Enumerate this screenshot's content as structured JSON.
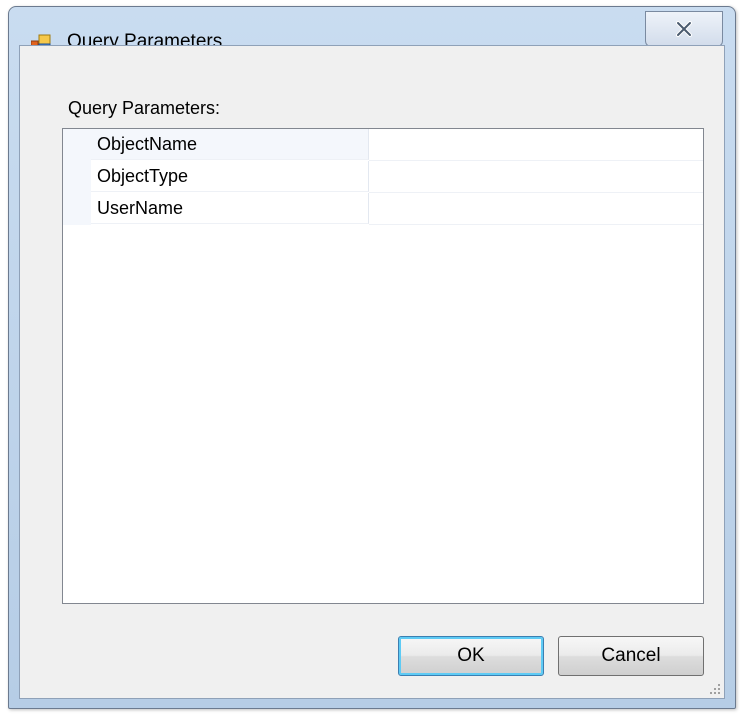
{
  "window": {
    "title": "Query Parameters",
    "close_label": "close"
  },
  "panel": {
    "label": "Query Parameters:"
  },
  "grid": {
    "rows": [
      {
        "name": "ObjectName",
        "value": ""
      },
      {
        "name": "ObjectType",
        "value": ""
      },
      {
        "name": "UserName",
        "value": ""
      }
    ]
  },
  "buttons": {
    "ok_label": "OK",
    "cancel_label": "Cancel"
  },
  "colors": {
    "title_bar": "#b6cde6",
    "client_background": "#f0f0f0",
    "default_button_border": "#3c7fb1"
  }
}
